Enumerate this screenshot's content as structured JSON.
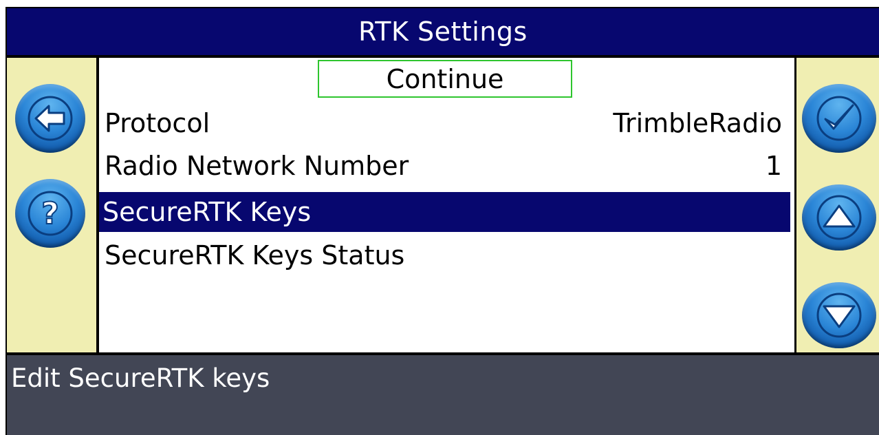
{
  "header": {
    "title": "RTK Settings"
  },
  "menu": {
    "continue_label": "Continue",
    "items": [
      {
        "label": "Protocol",
        "value": "TrimbleRadio"
      },
      {
        "label": "Radio Network Number",
        "value": "1"
      },
      {
        "label": "SecureRTK Keys",
        "value": "",
        "selected": true
      },
      {
        "label": "SecureRTK Keys Status",
        "value": ""
      }
    ]
  },
  "status_bar": {
    "text": "Edit SecureRTK keys"
  },
  "icons": {
    "left": [
      "back-arrow-icon",
      "help-icon"
    ],
    "right": [
      "checkmark-icon",
      "scroll-up-icon",
      "scroll-down-icon"
    ]
  },
  "colors": {
    "title_bg": "#07076f",
    "side_panel": "#f0eeb2",
    "selected_row": "#07076f",
    "continue_border": "#2ec52e",
    "status_bg": "#424655",
    "button_blue": "#2b86d7"
  }
}
